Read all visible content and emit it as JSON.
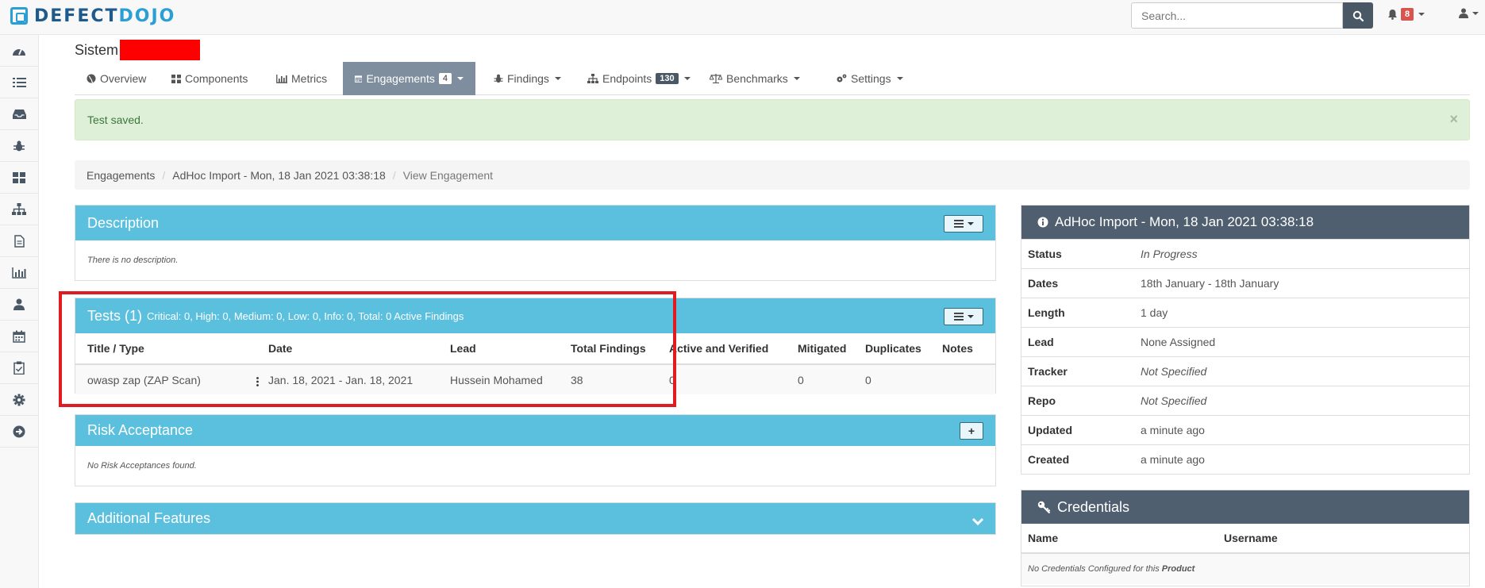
{
  "brand": {
    "part1": "DEFECT",
    "part2": "DOJO"
  },
  "topbar": {
    "search_placeholder": "Search...",
    "notification_count": "8"
  },
  "colors": {
    "accent": "#5bc0de",
    "dark": "#4f5f6f",
    "alert_bg": "#dff0d8",
    "highlight": "#e11b22",
    "redaction": "#ff0000"
  },
  "sidebar": {
    "items": [
      {
        "icon": "dashboard-icon"
      },
      {
        "icon": "list-icon"
      },
      {
        "icon": "inbox-icon"
      },
      {
        "icon": "bug-icon"
      },
      {
        "icon": "grid-icon"
      },
      {
        "icon": "sitemap-icon"
      },
      {
        "icon": "file-icon"
      },
      {
        "icon": "bar-chart-icon"
      },
      {
        "icon": "user-icon"
      },
      {
        "icon": "calendar-icon"
      },
      {
        "icon": "clipboard-icon"
      },
      {
        "icon": "gear-icon"
      },
      {
        "icon": "arrow-circle-right-icon"
      }
    ]
  },
  "product": {
    "title": "Sistem"
  },
  "tabs": [
    {
      "label": "Overview",
      "icon": "globe-icon"
    },
    {
      "label": "Components",
      "icon": "grid-icon"
    },
    {
      "label": "Metrics",
      "icon": "bar-chart-icon"
    },
    {
      "label": "Engagements",
      "icon": "calendar-icon",
      "badge": "4"
    },
    {
      "label": "Findings",
      "icon": "bug-icon"
    },
    {
      "label": "Endpoints",
      "icon": "sitemap-icon",
      "badge": "130"
    },
    {
      "label": "Benchmarks",
      "icon": "balance-icon"
    },
    {
      "label": "Settings",
      "icon": "gears-icon"
    }
  ],
  "alert": {
    "message": "Test saved.",
    "close": "×"
  },
  "breadcrumb": {
    "items": [
      "Engagements",
      "AdHoc Import - Mon, 18 Jan 2021 03:38:18"
    ],
    "current": "View Engagement",
    "separator": "/"
  },
  "description": {
    "title": "Description",
    "empty_text": "There is no description."
  },
  "tests": {
    "title": "Tests (1)",
    "summary": "Critical: 0, High: 0, Medium: 0, Low: 0, Info: 0, Total: 0 Active Findings",
    "columns": [
      "Title / Type",
      "Date",
      "Lead",
      "Total Findings",
      "Active and Verified",
      "Mitigated",
      "Duplicates",
      "Notes"
    ],
    "rows": [
      {
        "title": "owasp zap (ZAP Scan)",
        "date": "Jan. 18, 2021 - Jan. 18, 2021",
        "lead": "Hussein Mohamed",
        "total": "38",
        "active_verified": "0",
        "mitigated": "0",
        "duplicates": "0",
        "notes": ""
      }
    ]
  },
  "risk": {
    "title": "Risk Acceptance",
    "empty_text": "No Risk Acceptances found.",
    "add": "+"
  },
  "additional": {
    "title": "Additional Features"
  },
  "engagement_info": {
    "title": "AdHoc Import - Mon, 18 Jan 2021 03:38:18",
    "rows": [
      {
        "key": "Status",
        "value": "In Progress"
      },
      {
        "key": "Dates",
        "value": "18th January - 18th January"
      },
      {
        "key": "Length",
        "value": "1 day"
      },
      {
        "key": "Lead",
        "value": "None Assigned"
      },
      {
        "key": "Tracker",
        "value": "Not Specified"
      },
      {
        "key": "Repo",
        "value": "Not Specified"
      },
      {
        "key": "Updated",
        "value": "a minute ago"
      },
      {
        "key": "Created",
        "value": "a minute ago"
      }
    ]
  },
  "credentials": {
    "title": "Credentials",
    "columns": [
      "Name",
      "Username"
    ],
    "empty_text": "No Credentials Configured for this",
    "empty_bold": "Product"
  }
}
